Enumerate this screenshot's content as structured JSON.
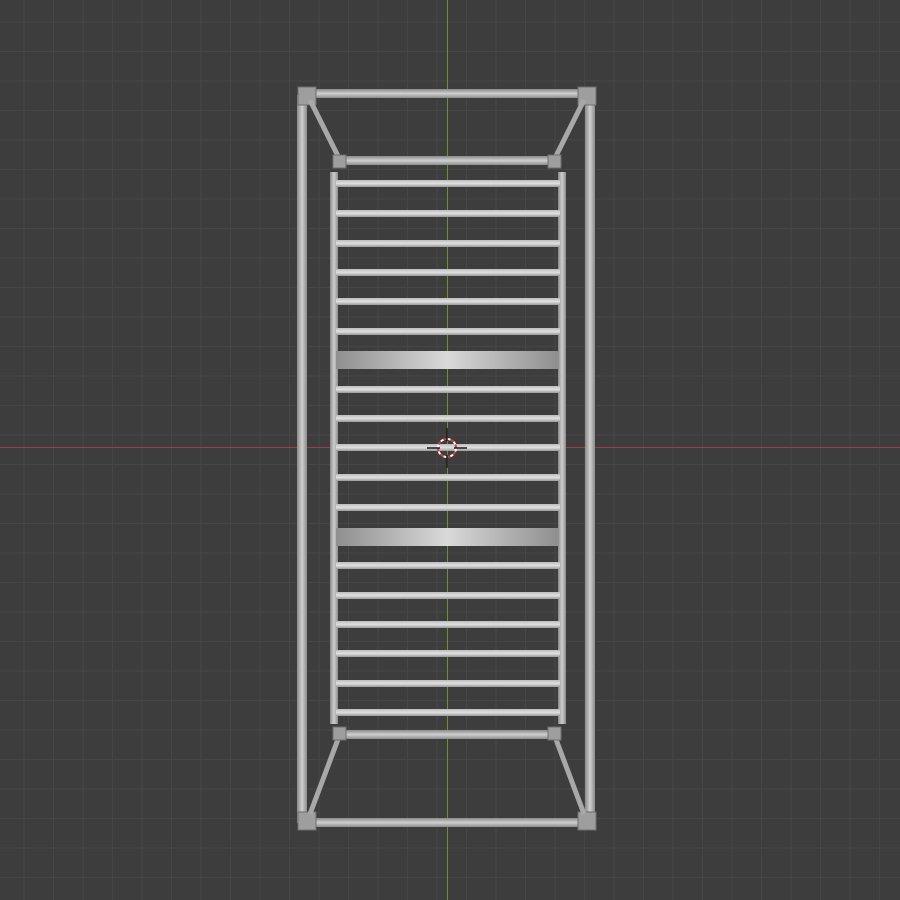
{
  "viewport": {
    "view": "top-orthographic",
    "grid": true,
    "colors": {
      "background": "#3d3d3d",
      "grid_line": "#464646",
      "x_axis": "#9c3f4b",
      "y_axis": "#6f8f2b",
      "mesh": "#a6a6a6"
    }
  },
  "scene": {
    "object": "bed-frame-with-slats",
    "slat_count": 19,
    "wide_slats": 2
  },
  "cursor": {
    "icon": "3d-cursor-icon"
  }
}
